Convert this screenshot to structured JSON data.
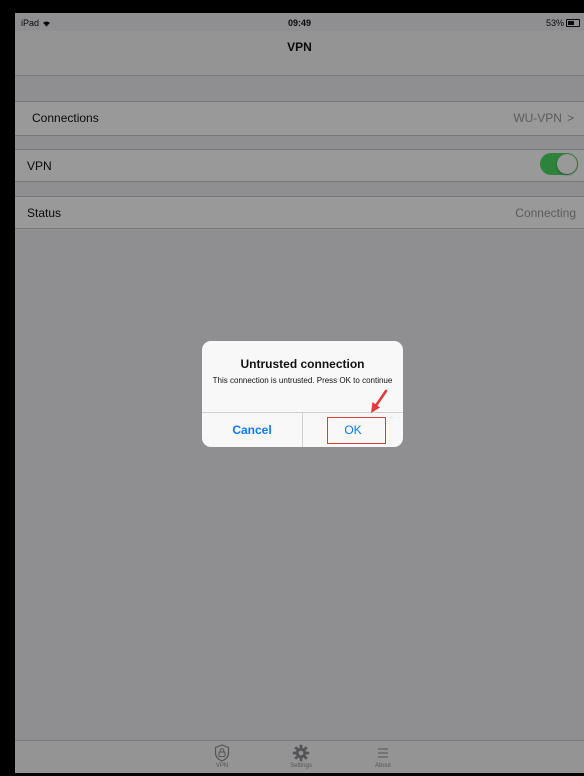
{
  "status_bar": {
    "device": "iPad",
    "time": "09:49",
    "battery": "53%"
  },
  "nav": {
    "title": "VPN"
  },
  "settings": {
    "connections_label": "Connections",
    "connections_value": "WU-VPN",
    "chevron": ">",
    "vpn_label": "VPN",
    "vpn_enabled": true,
    "status_label": "Status",
    "status_value": "Connecting"
  },
  "dialog": {
    "title": "Untrusted connection",
    "message": "This connection is untrusted. Press OK to continue",
    "cancel_label": "Cancel",
    "ok_label": "OK"
  },
  "tabs": [
    {
      "label": "VPN",
      "icon": "shield-lock-icon"
    },
    {
      "label": "Settings",
      "icon": "gear-icon"
    },
    {
      "label": "About",
      "icon": "list-icon"
    }
  ],
  "colors": {
    "toggle_on": "#4cd964",
    "ios_blue": "#0a7aff",
    "annotation_red": "#e03a3a"
  }
}
